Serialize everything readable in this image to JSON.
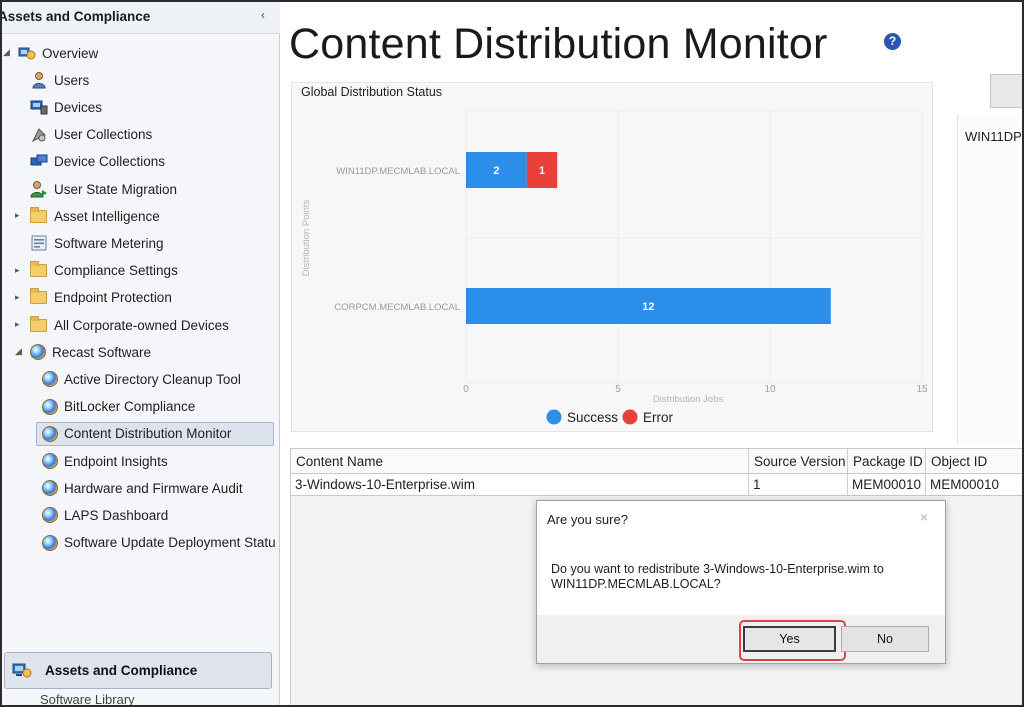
{
  "navigation": {
    "title": "Assets and Compliance",
    "collapse_icon": "‹",
    "items": [
      {
        "label": "Overview",
        "icon": "overview-icon",
        "arrow": "◢"
      },
      {
        "label": "Users",
        "icon": "users-icon"
      },
      {
        "label": "Devices",
        "icon": "devices-icon"
      },
      {
        "label": "User Collections",
        "icon": "user-collections-icon"
      },
      {
        "label": "Device Collections",
        "icon": "device-collections-icon"
      },
      {
        "label": "User State Migration",
        "icon": "user-state-migration-icon"
      },
      {
        "label": "Asset Intelligence",
        "icon": "folder-icon",
        "arrow": "▸"
      },
      {
        "label": "Software Metering",
        "icon": "software-metering-icon"
      },
      {
        "label": "Compliance Settings",
        "icon": "folder-icon",
        "arrow": "▸"
      },
      {
        "label": "Endpoint Protection",
        "icon": "folder-icon",
        "arrow": "▸"
      },
      {
        "label": "All Corporate-owned Devices",
        "icon": "folder-icon",
        "arrow": "▸"
      },
      {
        "label": "Recast Software",
        "icon": "recast-orb-icon",
        "arrow": "◢"
      },
      {
        "label": "Active Directory Cleanup Tool",
        "icon": "recast-orb-icon"
      },
      {
        "label": "BitLocker Compliance",
        "icon": "recast-orb-icon"
      },
      {
        "label": "Content Distribution Monitor",
        "icon": "recast-orb-icon",
        "selected": true
      },
      {
        "label": "Endpoint Insights",
        "icon": "recast-orb-icon"
      },
      {
        "label": "Hardware and Firmware Audit",
        "icon": "recast-orb-icon"
      },
      {
        "label": "LAPS Dashboard",
        "icon": "recast-orb-icon"
      },
      {
        "label": "Software Update Deployment Statu",
        "icon": "recast-orb-icon"
      }
    ],
    "workspace_button": "Assets and Compliance",
    "workspace_next": "Software Library"
  },
  "main": {
    "title": "Content Distribution Monitor",
    "help_icon": "?",
    "right_panel_label": "WIN11DP"
  },
  "chart_data": {
    "type": "bar",
    "orientation": "horizontal",
    "stacked": true,
    "title": "Global Distribution Status",
    "xlabel": "Distribution Jobs",
    "ylabel": "Distribution Points",
    "categories": [
      "WIN11DP.MECMLAB.LOCAL",
      "CORPCM.MECMLAB.LOCAL"
    ],
    "series": [
      {
        "name": "Success",
        "color": "#2b8ee8",
        "values": [
          2,
          12
        ]
      },
      {
        "name": "Error",
        "color": "#e8413c",
        "values": [
          1,
          0
        ]
      }
    ],
    "xlim": [
      0,
      15
    ],
    "xticks": [
      0,
      5,
      10,
      15
    ],
    "grid": true,
    "legend": "bottom-center"
  },
  "grid": {
    "columns": [
      "Content Name",
      "Source Version",
      "Package ID",
      "Object ID"
    ],
    "rows": [
      [
        "3-Windows-10-Enterprise.wim",
        "1",
        "MEM00010",
        "MEM00010"
      ]
    ]
  },
  "dialog": {
    "title": "Are you sure?",
    "close_icon": "×",
    "message": "Do you want to redistribute 3-Windows-10-Enterprise.wim to WIN11DP.MECMLAB.LOCAL?",
    "yes_label": "Yes",
    "no_label": "No"
  }
}
